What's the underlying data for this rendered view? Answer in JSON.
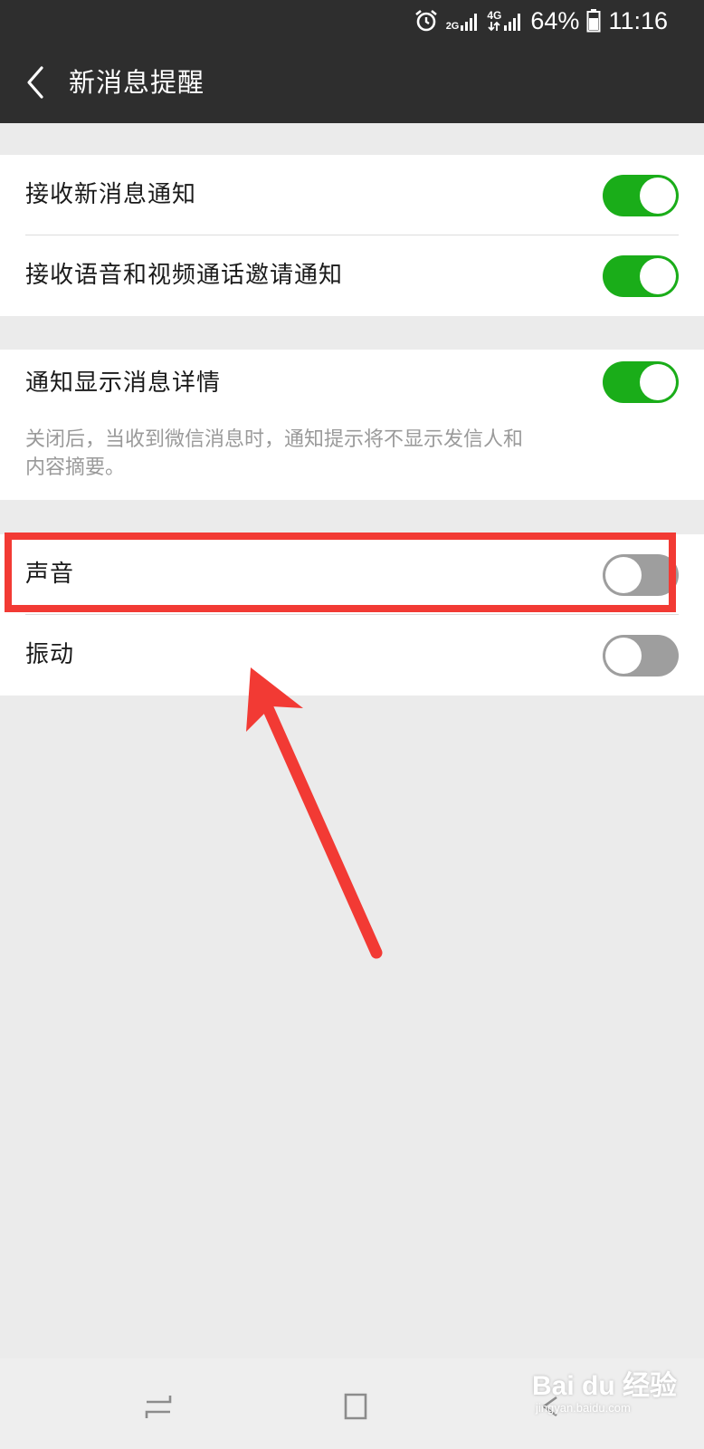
{
  "status_bar": {
    "network_2g": "2G",
    "network_4g": "4G",
    "battery": "64%",
    "time": "11:16",
    "icons": [
      "alarm-icon",
      "signal-2g-icon",
      "signal-4g-icon",
      "battery-icon"
    ]
  },
  "header": {
    "back_icon": "chevron-left-icon",
    "title": "新消息提醒"
  },
  "settings": {
    "group1": [
      {
        "label": "接收新消息通知",
        "enabled": true
      },
      {
        "label": "接收语音和视频通话邀请通知",
        "enabled": true
      }
    ],
    "group2": {
      "label": "通知显示消息详情",
      "enabled": true,
      "description": "关闭后，当收到微信消息时，通知提示将不显示发信人和内容摘要。"
    },
    "group3": [
      {
        "label": "声音",
        "enabled": false
      },
      {
        "label": "振动",
        "enabled": false
      }
    ]
  },
  "colors": {
    "toggle_on": "#1aad19",
    "toggle_off": "#9e9e9e",
    "annotation": "#f23a34",
    "header_bg": "#2e2e2e",
    "page_bg": "#ebebeb"
  },
  "annotation": {
    "highlighted_item": "声音"
  },
  "system_nav": {
    "keys": [
      "recent-apps-icon",
      "home-icon",
      "back-icon"
    ]
  },
  "watermark": {
    "brand": "Bai du 经验",
    "url": "jingyan.baidu.com"
  }
}
